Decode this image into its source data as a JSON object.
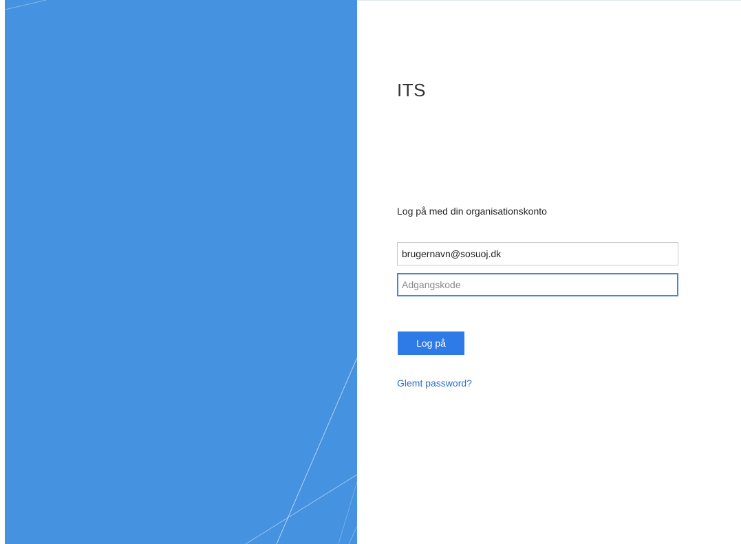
{
  "brand": {
    "app_title": "ITS",
    "accent_color": "#2e7ae6",
    "illustration_color": "#4592e0"
  },
  "login": {
    "prompt": "Log på med din organisationskonto",
    "username_value": "brugernavn@sosuoj.dk",
    "password_placeholder": "Adgangskode",
    "password_value": "",
    "submit_label": "Log på",
    "forgot_password_label": "Glemt password?"
  }
}
